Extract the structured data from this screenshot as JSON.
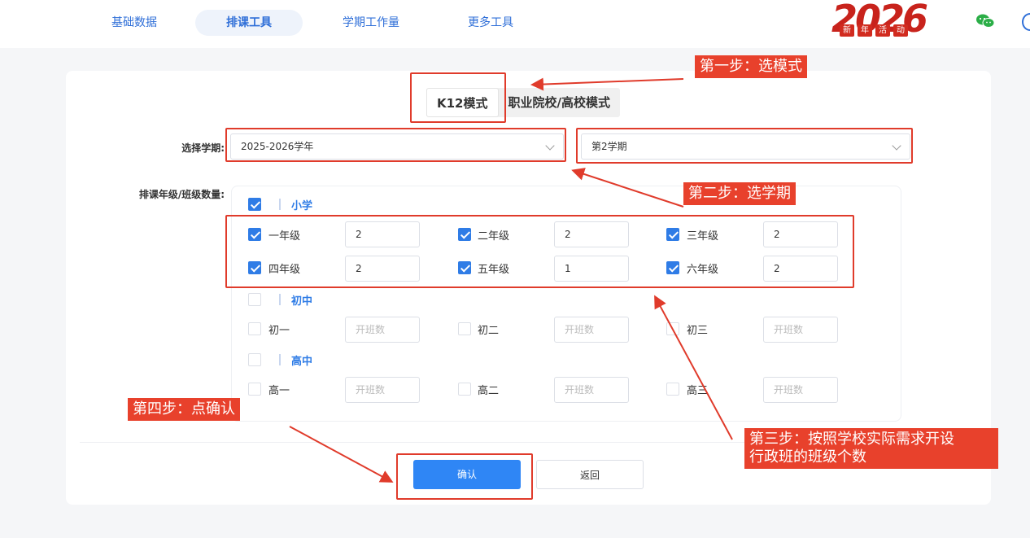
{
  "nav": {
    "tabs": [
      {
        "label": "基础数据",
        "active": false
      },
      {
        "label": "排课工具",
        "active": true
      },
      {
        "label": "学期工作量",
        "active": false
      },
      {
        "label": "更多工具",
        "active": false
      }
    ],
    "promo": {
      "year": "2026",
      "chars": [
        "新",
        "年",
        "活",
        "动"
      ]
    }
  },
  "mode_tabs": [
    {
      "label": "K12模式",
      "active": true
    },
    {
      "label": "职业院校/高校模式",
      "active": false
    }
  ],
  "form": {
    "semester_label": "选择学期:",
    "year_value": "2025-2026学年",
    "term_value": "第2学期",
    "grades_label": "排课年级/班级数量:",
    "placeholder": "开班数"
  },
  "sections": [
    {
      "title": "小学",
      "checked": true,
      "grades": [
        {
          "label": "一年级",
          "checked": true,
          "value": "2"
        },
        {
          "label": "二年级",
          "checked": true,
          "value": "2"
        },
        {
          "label": "三年级",
          "checked": true,
          "value": "2"
        },
        {
          "label": "四年级",
          "checked": true,
          "value": "2"
        },
        {
          "label": "五年级",
          "checked": true,
          "value": "1"
        },
        {
          "label": "六年级",
          "checked": true,
          "value": "2"
        }
      ]
    },
    {
      "title": "初中",
      "checked": false,
      "grades": [
        {
          "label": "初一",
          "checked": false,
          "value": ""
        },
        {
          "label": "初二",
          "checked": false,
          "value": ""
        },
        {
          "label": "初三",
          "checked": false,
          "value": ""
        }
      ]
    },
    {
      "title": "高中",
      "checked": false,
      "grades": [
        {
          "label": "高一",
          "checked": false,
          "value": ""
        },
        {
          "label": "高二",
          "checked": false,
          "value": ""
        },
        {
          "label": "高三",
          "checked": false,
          "value": ""
        }
      ]
    }
  ],
  "buttons": {
    "confirm": "确认",
    "back": "返回"
  },
  "annotations": {
    "step1": "第一步：选模式",
    "step2": "第二步：选学期",
    "step3_line1": "第三步：按照学校实际需求开设",
    "step3_line2": "行政班的班级个数",
    "step4": "第四步：点确认"
  },
  "colors": {
    "accent": "#2f7ce6",
    "annotation": "#e8412c"
  }
}
